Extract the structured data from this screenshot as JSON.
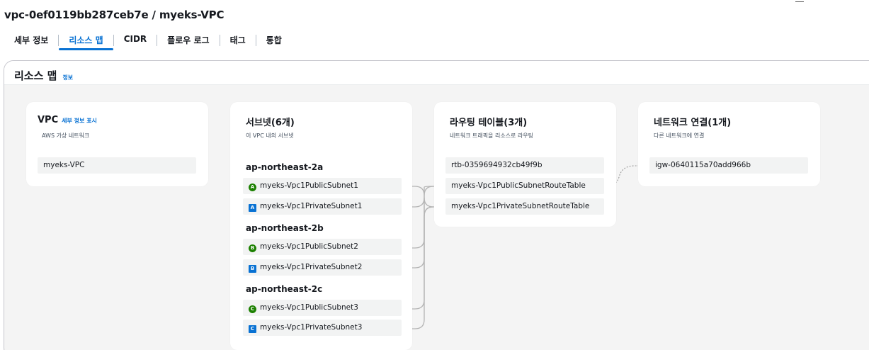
{
  "page": {
    "title": "vpc-0ef0119bb287ceb7e / myeks-VPC"
  },
  "tabs": [
    {
      "label": "세부 정보"
    },
    {
      "label": "리소스 맵"
    },
    {
      "label": "CIDR"
    },
    {
      "label": "플로우 로그"
    },
    {
      "label": "태그"
    },
    {
      "label": "통합"
    }
  ],
  "resource_map": {
    "title": "리소스 맵",
    "info_link": "정보"
  },
  "vpc_card": {
    "title": "VPC",
    "link": "세부 정보 표시",
    "subtitle": "AWS 가상 네트워크",
    "item": "myeks-VPC"
  },
  "subnet_card": {
    "title": "서브넷(6개)",
    "subtitle": "이 VPC 내의 서브넷",
    "zones": [
      {
        "name": "ap-northeast-2a",
        "subnets": [
          {
            "icon": "A",
            "type": "public",
            "label": "myeks-Vpc1PublicSubnet1"
          },
          {
            "icon": "A",
            "type": "private",
            "label": "myeks-Vpc1PrivateSubnet1"
          }
        ]
      },
      {
        "name": "ap-northeast-2b",
        "subnets": [
          {
            "icon": "B",
            "type": "public",
            "label": "myeks-Vpc1PublicSubnet2"
          },
          {
            "icon": "B",
            "type": "private",
            "label": "myeks-Vpc1PrivateSubnet2"
          }
        ]
      },
      {
        "name": "ap-northeast-2c",
        "subnets": [
          {
            "icon": "C",
            "type": "public",
            "label": "myeks-Vpc1PublicSubnet3"
          },
          {
            "icon": "C",
            "type": "private",
            "label": "myeks-Vpc1PrivateSubnet3"
          }
        ]
      }
    ]
  },
  "route_card": {
    "title": "라우팅 테이블(3개)",
    "subtitle": "네트워크 트래픽을 리소스로 라우팅",
    "items": [
      "rtb-0359694932cb49f9b",
      "myeks-Vpc1PublicSubnetRouteTable",
      "myeks-Vpc1PrivateSubnetRouteTable"
    ]
  },
  "network_card": {
    "title": "네트워크 연결(1개)",
    "subtitle": "다른 네트워크에 연결",
    "items": [
      "igw-0640115a70add966b"
    ]
  },
  "colors": {
    "accent": "#0972d3",
    "public_subnet": "#1d8102",
    "private_subnet": "#0972d3",
    "connector": "#b4b4b4"
  }
}
